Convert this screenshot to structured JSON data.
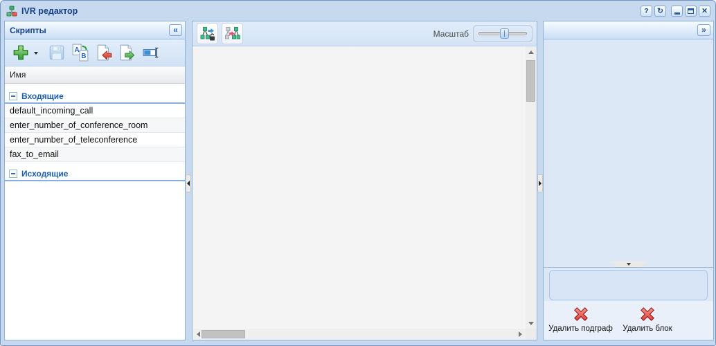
{
  "colors": {
    "accent_blue": "#15428b",
    "delete_red": "#d4281c",
    "add_green": "#2f9a3f"
  },
  "window": {
    "title": "IVR редактор",
    "tools": {
      "help": "?",
      "refresh": "↻",
      "close": "✕"
    }
  },
  "left_panel": {
    "title": "Скрипты",
    "collapse_glyph": "«",
    "toolbar_icons": [
      "add-script",
      "add-script-menu",
      "save-script",
      "duplicate-script",
      "import-script",
      "export-script",
      "rename-script"
    ],
    "grid": {
      "column_header": "Имя",
      "groups": [
        {
          "label": "Входящие",
          "items": [
            "default_incoming_call",
            "enter_number_of_conference_room",
            "enter_number_of_teleconference",
            "fax_to_email"
          ]
        },
        {
          "label": "Исходящие",
          "items": []
        }
      ]
    }
  },
  "center_panel": {
    "toolbar_icons": [
      "export-graph",
      "apply-graph"
    ],
    "zoom": {
      "label": "Масштаб",
      "thumb_left": "44%"
    }
  },
  "right_panel": {
    "expand_glyph": "»",
    "actions": [
      {
        "label": "Удалить подграф"
      },
      {
        "label": "Удалить блок"
      }
    ]
  }
}
